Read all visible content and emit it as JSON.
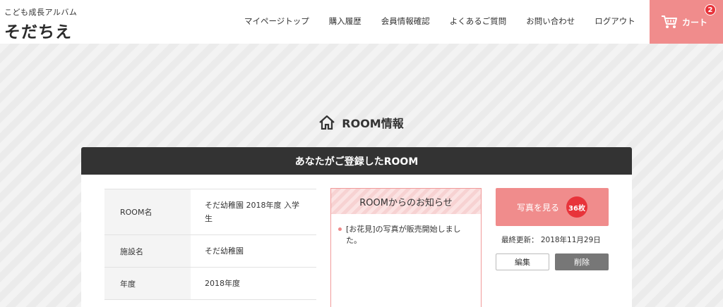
{
  "header": {
    "logo_subtitle": "こども成長アルバム",
    "logo_title": "そだちえ",
    "nav": [
      {
        "label": "マイページトップ"
      },
      {
        "label": "購入履歴"
      },
      {
        "label": "会員情報確認"
      },
      {
        "label": "よくあるご質問"
      },
      {
        "label": "お問い合わせ"
      },
      {
        "label": "ログアウト"
      }
    ],
    "cart": {
      "label": "カート",
      "count": "2",
      "icon": "cart-icon"
    }
  },
  "page": {
    "title": "ROOM情報",
    "title_icon": "home-icon",
    "panel_title": "あなたがご登録したROOM"
  },
  "room_info": {
    "rows": [
      {
        "label": "ROOM名",
        "value": "そだ幼稚園 2018年度 入学生"
      },
      {
        "label": "施設名",
        "value": "そだ幼稚園"
      },
      {
        "label": "年度",
        "value": "2018年度"
      }
    ]
  },
  "notice": {
    "title": "ROOMからのお知らせ",
    "items": [
      {
        "text": "[お花見]の写真が販売開始しました。"
      }
    ]
  },
  "actions": {
    "view_label": "写真を見る",
    "photo_count": "36枚",
    "updated": "最終更新： 2018年11月29日",
    "edit_label": "編集",
    "delete_label": "削除"
  },
  "colors": {
    "accent": "#f08c8c",
    "badge": "#e8333a",
    "dark_header": "#333333"
  }
}
